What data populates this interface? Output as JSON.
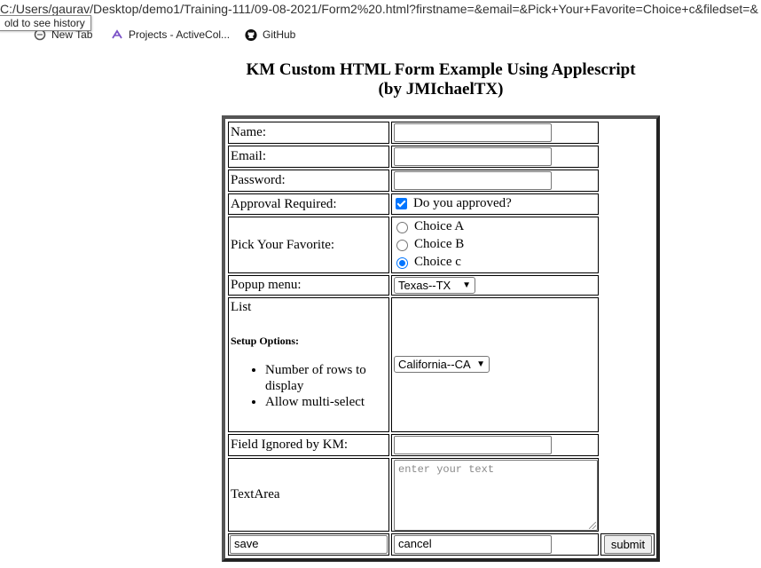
{
  "browser": {
    "url": "C:/Users/gaurav/Desktop/demo1/Training-111/09-08-2021/Form2%20.html?firstname=&email=&Pick+Your+Favorite=Choice+c&filedset=&",
    "tooltip": "old to see history",
    "bookmarks": [
      {
        "label": "New Tab",
        "icon": "new-tab-icon"
      },
      {
        "label": "Projects - ActiveCol...",
        "icon": "activecollab-icon"
      },
      {
        "label": "GitHub",
        "icon": "github-icon"
      }
    ]
  },
  "page": {
    "title_line1": "KM Custom HTML Form Example Using Applescript",
    "title_line2": "(by JMIchaelTX)"
  },
  "form": {
    "name_label": "Name:",
    "name_value": "",
    "email_label": "Email:",
    "email_value": "",
    "password_label": "Password:",
    "password_value": "",
    "approval_label": "Approval Required:",
    "approval_checkbox_label": "Do you approved?",
    "approval_checked": true,
    "favorite_label": "Pick Your Favorite:",
    "choices": [
      {
        "label": "Choice A",
        "selected": false
      },
      {
        "label": "Choice B",
        "selected": false
      },
      {
        "label": "Choice c",
        "selected": true
      }
    ],
    "popup_label": "Popup menu:",
    "popup_value": "Texas--TX",
    "list_label": "List",
    "setup_options_heading": "Setup Options:",
    "setup_options": [
      "Number of rows to display",
      "Allow multi-select"
    ],
    "list_value": "California--CA",
    "ignored_label": "Field Ignored by KM:",
    "ignored_value": "",
    "textarea_label": "TextArea",
    "textarea_placeholder": "enter your text",
    "save_value": "save",
    "cancel_value": "cancel",
    "submit_label": "submit"
  },
  "colors": {
    "accent": "#0075ff",
    "table_border": "#555555"
  }
}
